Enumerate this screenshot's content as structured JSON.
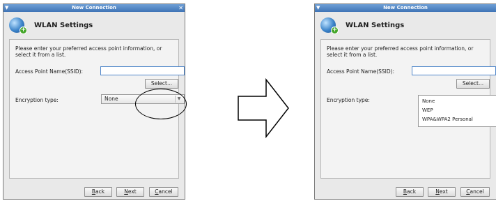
{
  "dialog": {
    "title": "New Connection",
    "header": "WLAN Settings",
    "instructions": "Please enter your preferred access point information, or select it from a list.",
    "ssid_label": "Access Point Name(SSID):",
    "ssid_value": "",
    "select_button": "Select...",
    "encryption_label": "Encryption type:",
    "encryption_selected": "None",
    "encryption_options": [
      "None",
      "WEP",
      "WPA&WPA2 Personal"
    ],
    "buttons": {
      "back": "Back",
      "next": "Next",
      "cancel": "Cancel"
    }
  },
  "icons": {
    "window_menu": "window-menu-icon",
    "close": "close-icon",
    "network": "network-globe-icon",
    "dropdown": "chevron-down-icon",
    "transition": "right-arrow-icon"
  },
  "colors": {
    "titlebar": "#3f74b6",
    "focus_border": "#4f86c9"
  }
}
